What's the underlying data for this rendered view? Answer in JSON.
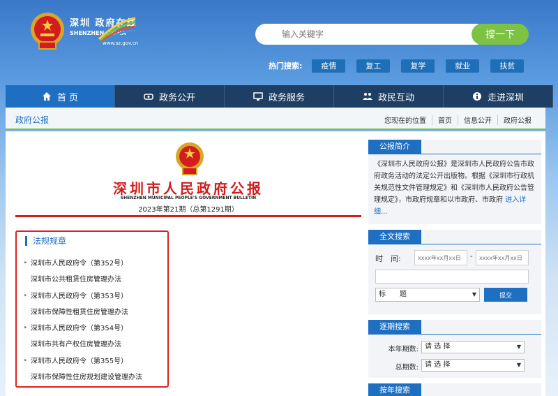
{
  "logo": {
    "cn": "深圳 政府在线",
    "en": "SHENZHEN CHINA",
    "url": "www.sz.gov.cn"
  },
  "search": {
    "placeholder": "输入关键字",
    "button": "搜一下"
  },
  "hot": {
    "label": "热门搜索:",
    "tags": [
      "疫情",
      "复工",
      "复学",
      "就业",
      "扶贫"
    ]
  },
  "nav": [
    {
      "label": "首 页",
      "icon": "home-icon"
    },
    {
      "label": "政务公开",
      "icon": "gov-open-icon"
    },
    {
      "label": "政务服务",
      "icon": "monitor-icon"
    },
    {
      "label": "政民互动",
      "icon": "people-icon"
    },
    {
      "label": "走进深圳",
      "icon": "info-icon"
    }
  ],
  "breadcrumb": {
    "title": "政府公报",
    "path": [
      "您现在的位置",
      "首页",
      "信息公开",
      "政府公报"
    ]
  },
  "bulletin": {
    "title": "深圳市人民政府公报",
    "en": "SHENZHEN MUNICIPAL PEOPLE'S GOVERNMENT BULLETIN",
    "issue": "2023年第21期（总第1291期）"
  },
  "laws": {
    "heading": "法规规章",
    "items": [
      {
        "text": "深圳市人民政府令（第352号）",
        "bullet": true
      },
      {
        "text": "深圳市公共租赁住房管理办法",
        "bullet": false
      },
      {
        "text": "深圳市人民政府令（第353号）",
        "bullet": true
      },
      {
        "text": "深圳市保障性租赁住房管理办法",
        "bullet": false
      },
      {
        "text": "深圳市人民政府令（第354号）",
        "bullet": true
      },
      {
        "text": "深圳市共有产权住房管理办法",
        "bullet": false
      },
      {
        "text": "深圳市人民政府令（第355号）",
        "bullet": true
      },
      {
        "text": "深圳市保障性住房规划建设管理办法",
        "bullet": false
      }
    ]
  },
  "intro": {
    "title": "公报简介",
    "text": "《深圳市人民政府公报》是深圳市人民政府公告市政府政务活动的法定公开出版物。根据《深圳市行政机关规范性文件管理规定》和《深圳市人民政府公告管理规定》，市政府规章和以市政府、市政府 ",
    "more": "进入详细..."
  },
  "fulltext": {
    "title": "全文搜索",
    "time_label": "时　间:",
    "date_placeholder": "xxxx年xx月xx日",
    "dash": "-",
    "field_select": "标　　题",
    "submit": "提交"
  },
  "period": {
    "title": "逐期搜索",
    "year_label": "本年期数:",
    "total_label": "总期数:",
    "select_default": "请 选 择"
  },
  "byyear": {
    "title": "按年搜索"
  },
  "colors": {
    "brand_blue": "#1e6fc2",
    "nav_dark": "#1e3e63",
    "accent_green": "#7dc242",
    "red": "#d31c1c"
  }
}
